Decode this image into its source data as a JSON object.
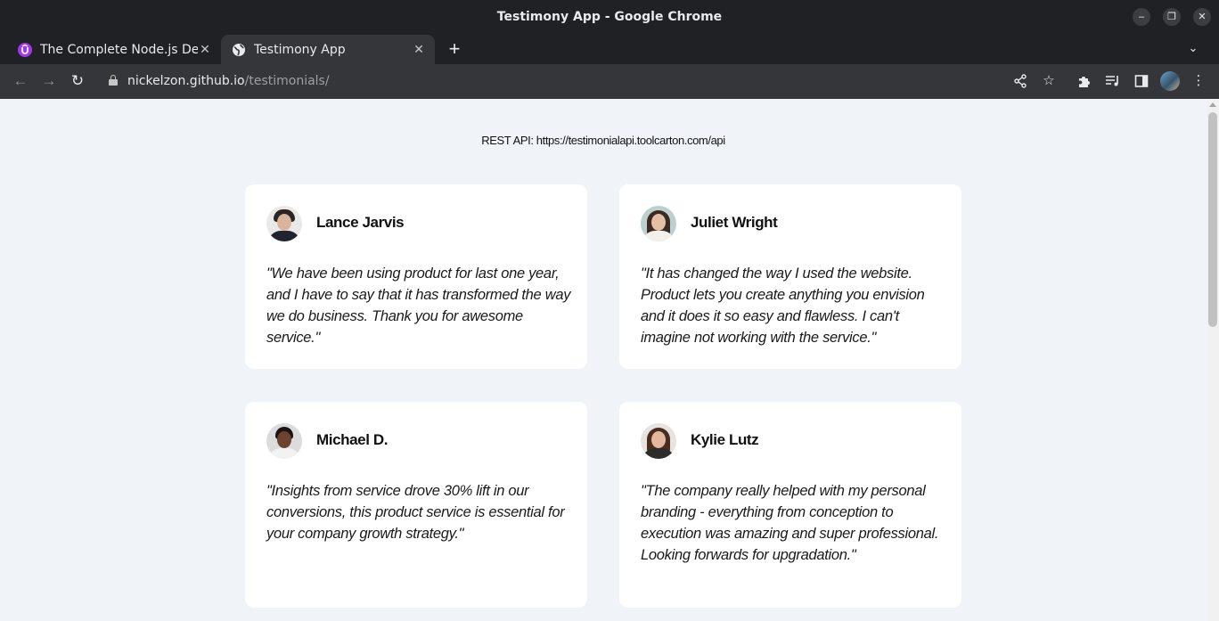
{
  "window": {
    "title": "Testimony App - Google Chrome"
  },
  "tabs": [
    {
      "label": "The Complete Node.js Dev",
      "active": false,
      "favicon": "udemy-icon",
      "favicon_color": "#a435f0"
    },
    {
      "label": "Testimony App",
      "active": true,
      "favicon": "globe-icon"
    }
  ],
  "address_bar": {
    "host": "nickelzon.github.io",
    "path": "/testimonials/"
  },
  "page": {
    "api_text": "REST API: https://testimonialapi.toolcarton.com/api",
    "background": "#f0f4f8",
    "testimonials": [
      {
        "name": "Lance Jarvis",
        "quote": "\"We have been using product for last one year, and I have to say that it has transformed the way we do business. Thank you for awesome service.\""
      },
      {
        "name": "Juliet Wright",
        "quote": "\"It has changed the way I used the website. Product lets you create anything you envision and it does it so easy and flawless. I can't imagine not working with the service.\""
      },
      {
        "name": "Michael D.",
        "quote": "\"Insights from service drove 30% lift in our conversions, this product service is essential for your company growth strategy.\""
      },
      {
        "name": "Kylie Lutz",
        "quote": "\"The company really helped with my personal branding - everything from conception to execution was amazing and super professional. Looking forwards for upgradation.\""
      }
    ]
  }
}
